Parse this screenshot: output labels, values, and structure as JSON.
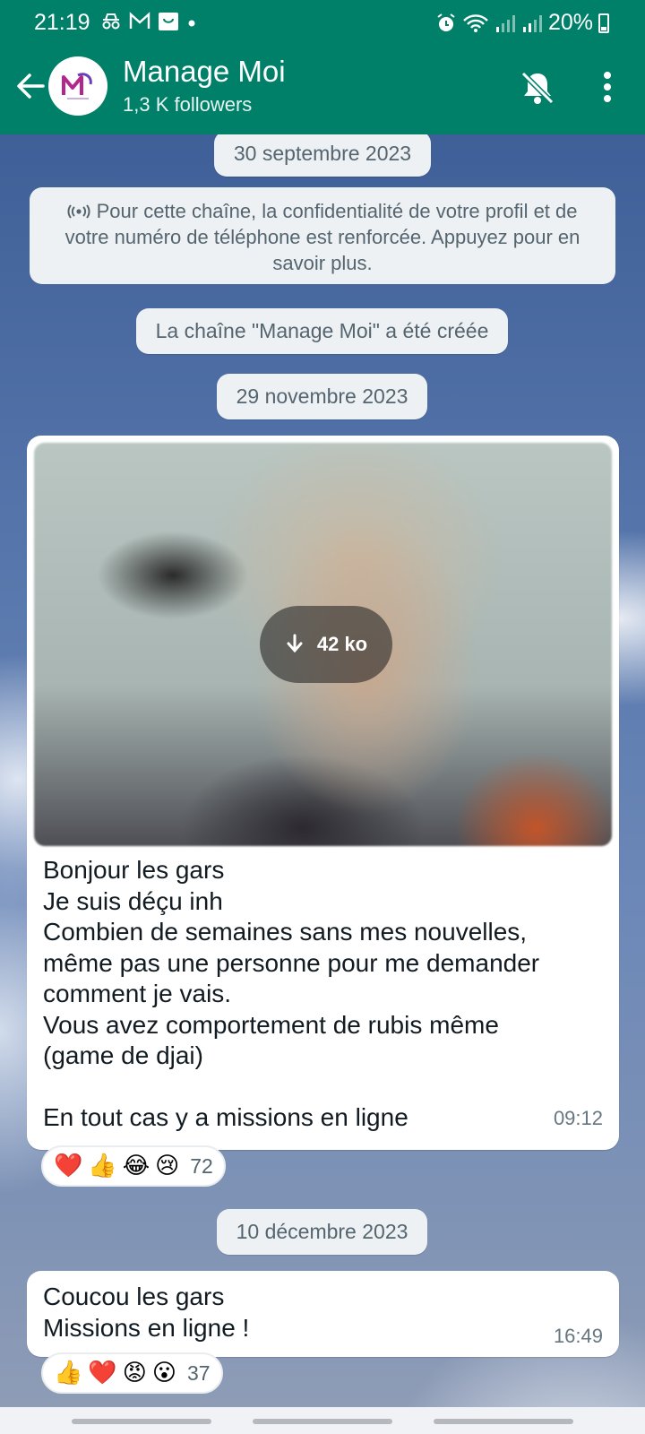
{
  "status_bar": {
    "time": "21:19",
    "battery": "20%",
    "left_icons": [
      "incognito-icon",
      "gmail-icon",
      "shop-icon",
      "dot-icon"
    ],
    "right_icons": [
      "alarm-icon",
      "wifi-icon",
      "signal-icon",
      "signal-icon",
      "battery-icon"
    ]
  },
  "header": {
    "title": "Manage Moi",
    "subtitle": "1,3 K followers",
    "colors": {
      "bar": "#008069"
    }
  },
  "chat": {
    "date1": "30 septembre 2023",
    "privacy_notice": "Pour cette chaîne, la confidentialité de votre profil et de votre numéro de téléphone est renforcée. Appuyez pour en savoir plus.",
    "created": "La chaîne \"Manage Moi\" a été créée",
    "date2": "29 novembre 2023",
    "date3": "10 décembre 2023",
    "messages": [
      {
        "media_size": "42 ko",
        "text": "Bonjour les gars\nJe suis déçu inh\nCombien de semaines sans mes nouvelles,\nmême pas une personne pour me demander\ncomment je vais.\nVous avez comportement de rubis même\n(game de djai)\n\nEn tout cas y a missions en ligne",
        "time": "09:12",
        "reactions": [
          "❤️",
          "👍",
          "😂",
          "😢"
        ],
        "reaction_count": "72"
      },
      {
        "text": "Coucou les gars\nMissions en ligne !",
        "time": "16:49",
        "reactions": [
          "👍",
          "❤️",
          "😡",
          "😮"
        ],
        "reaction_count": "37"
      }
    ]
  }
}
